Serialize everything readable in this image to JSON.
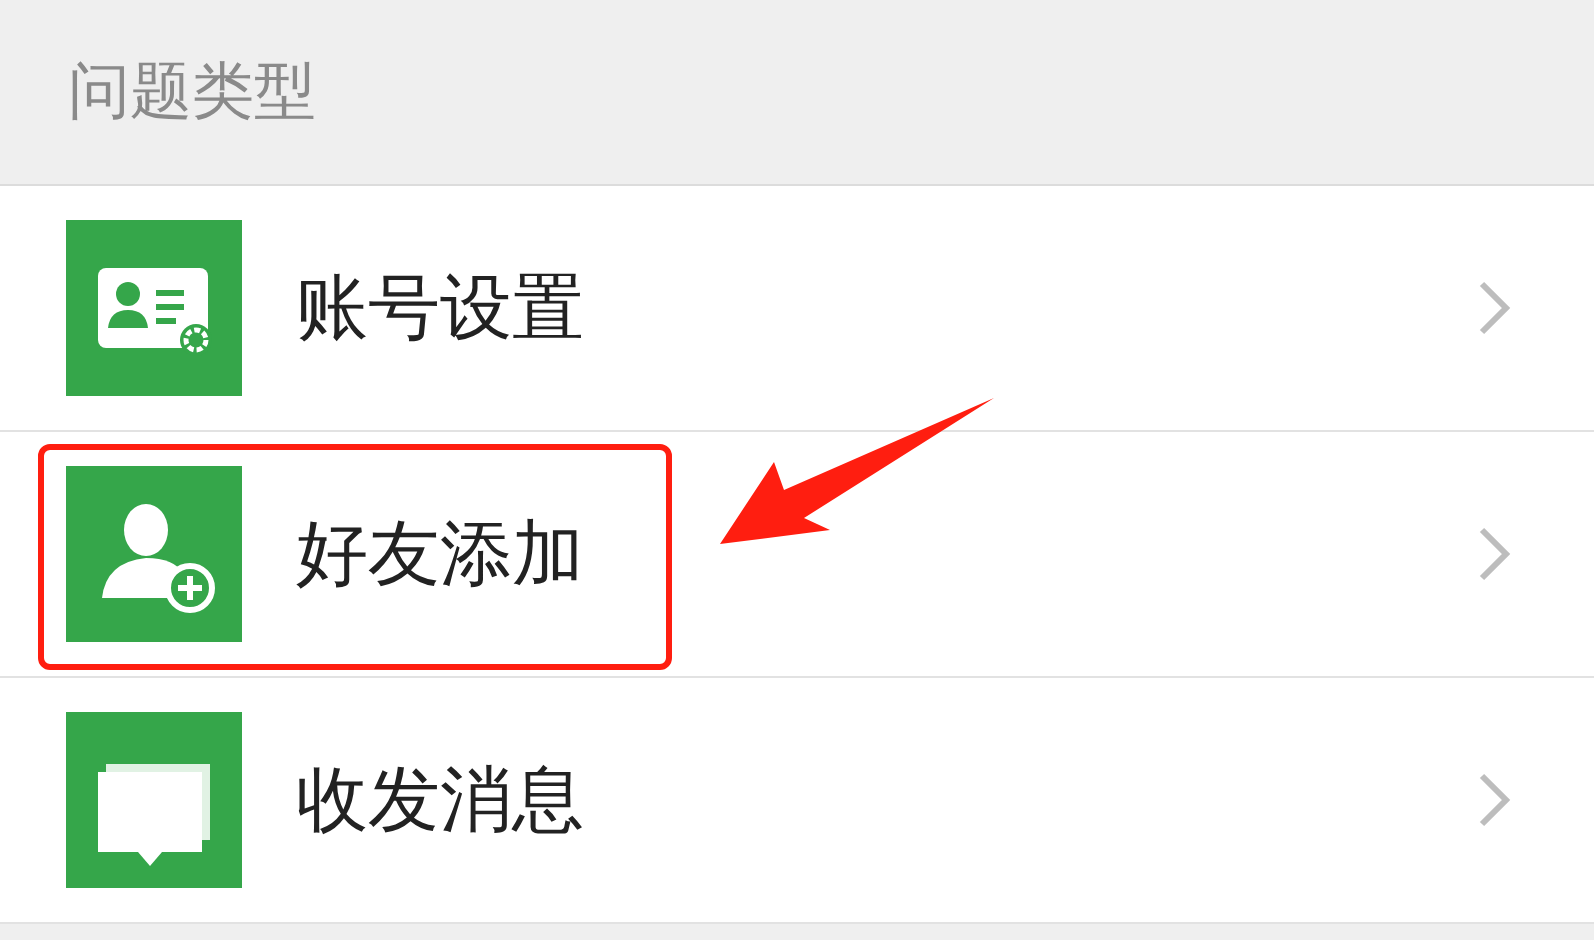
{
  "section": {
    "title": "问题类型"
  },
  "items": [
    {
      "label": "账号设置",
      "highlighted": false
    },
    {
      "label": "好友添加",
      "highlighted": true
    },
    {
      "label": "收发消息",
      "highlighted": false
    }
  ]
}
